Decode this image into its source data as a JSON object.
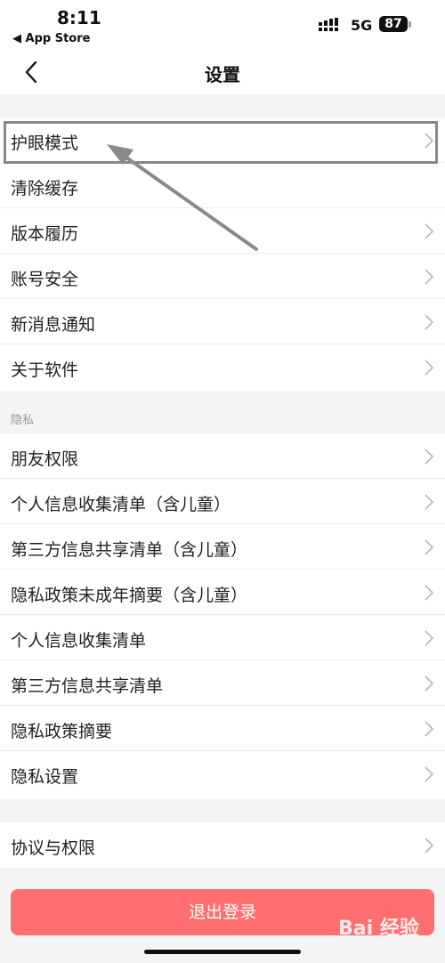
{
  "status_bar": {
    "time": "8:11",
    "back_app": "◀ App Store",
    "network": "5G",
    "battery": "87"
  },
  "nav": {
    "title": "设置"
  },
  "group1": [
    {
      "label": "护眼模式",
      "chevron": true
    },
    {
      "label": "清除缓存",
      "chevron": false
    },
    {
      "label": "版本履历",
      "chevron": true
    },
    {
      "label": "账号安全",
      "chevron": true
    },
    {
      "label": "新消息通知",
      "chevron": true
    },
    {
      "label": "关于软件",
      "chevron": true
    }
  ],
  "privacy_section": {
    "title": "隐私"
  },
  "group2": [
    {
      "label": "朋友权限"
    },
    {
      "label": "个人信息收集清单（含儿童）"
    },
    {
      "label": "第三方信息共享清单（含儿童）"
    },
    {
      "label": "隐私政策未成年摘要（含儿童）"
    },
    {
      "label": "个人信息收集清单"
    },
    {
      "label": "第三方信息共享清单"
    },
    {
      "label": "隐私政策摘要"
    },
    {
      "label": "隐私设置"
    }
  ],
  "group3": [
    {
      "label": "协议与权限"
    }
  ],
  "logout": {
    "label": "退出登录"
  },
  "watermark": "Bai 经验",
  "colors": {
    "logout_bg": "#ff6f6f",
    "background": "#f4f4f4"
  }
}
